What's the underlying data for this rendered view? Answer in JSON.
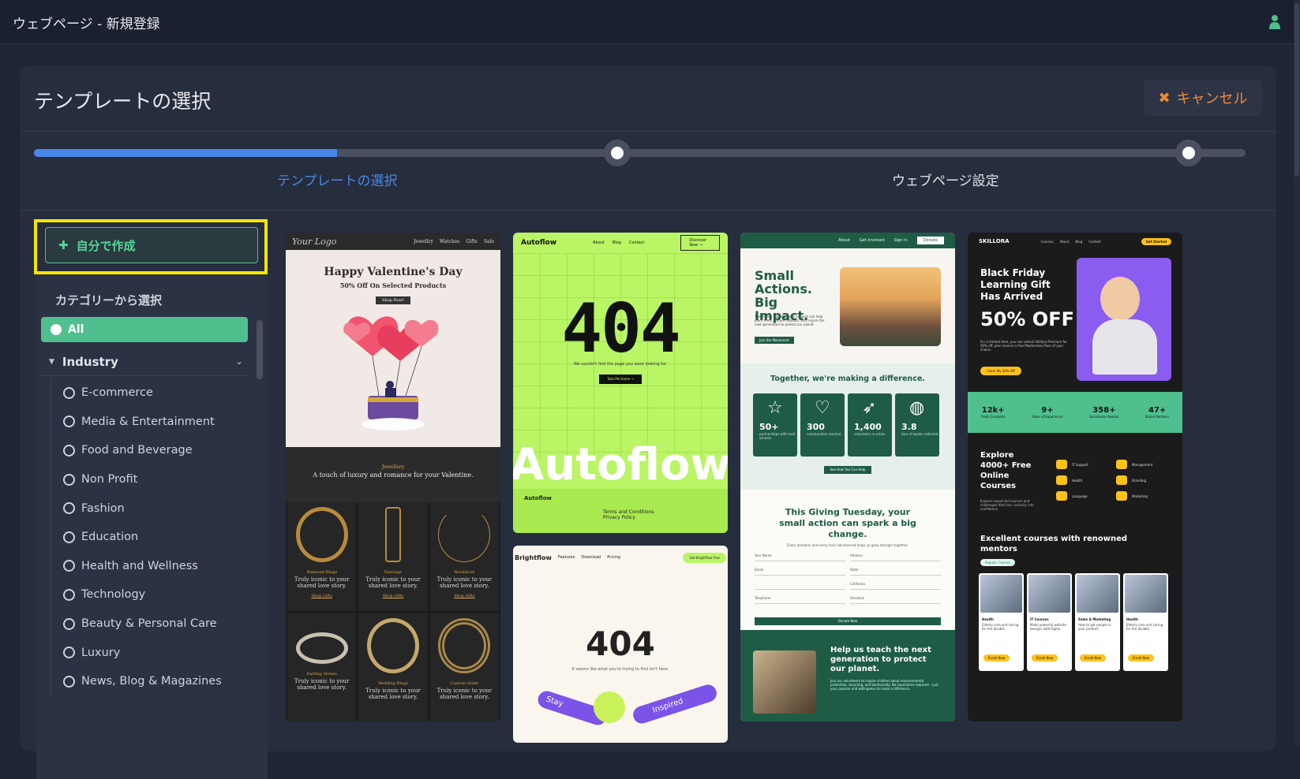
{
  "window": {
    "title": "ウェブページ - 新規登録"
  },
  "header": {
    "title": "テンプレートの選択",
    "cancel_label": "キャンセル"
  },
  "stepper": {
    "progress": 0.25,
    "steps": [
      {
        "label": "テンプレートの選択",
        "state": "active"
      },
      {
        "label": "ウェブページ設定",
        "state": "pending"
      }
    ]
  },
  "sidebar": {
    "create_label": "自分で作成",
    "category_title": "カテゴリーから選択",
    "all_label": "All",
    "group_label": "Industry",
    "items": [
      "E-commerce",
      "Media & Entertainment",
      "Food and Beverage",
      "Non Profit",
      "Fashion",
      "Education",
      "Health and Wellness",
      "Technology",
      "Beauty & Personal Care",
      "Luxury",
      "News, Blog & Magazines"
    ]
  },
  "templates": {
    "valentine": {
      "logo": "Your Logo",
      "nav": [
        "Jewellry",
        "Watches",
        "Gifts",
        "Sale"
      ],
      "heading": "Happy Valentine's Day",
      "sub": "50% Off On Selected Products",
      "button": "Shop Now!",
      "kicker": "Jewellery",
      "tagline": "A touch of luxury and romance for your Valentine.",
      "products": [
        {
          "name": "Diamond Rings",
          "desc": "Truly iconic to your shared love story.",
          "link": "Shop Gifts"
        },
        {
          "name": "Earrings",
          "desc": "Truly iconic to your shared love story.",
          "link": "Shop Gifts"
        },
        {
          "name": "Necklaces",
          "desc": "Truly iconic to your shared love story.",
          "link": "Shop Gifts"
        },
        {
          "name": "Earring Stones",
          "desc": "Truly iconic to your shared love story.",
          "link": ""
        },
        {
          "name": "Wedding Rings",
          "desc": "Truly iconic to your shared love story.",
          "link": ""
        },
        {
          "name": "Custom Order",
          "desc": "Truly iconic to your shared love story.",
          "link": ""
        }
      ]
    },
    "autoflow": {
      "brand": "Autoflow",
      "nav": [
        "About",
        "Blog",
        "Contact"
      ],
      "nav_button": "Discover Now →",
      "code": "404",
      "message": "We couldn't find the page you were looking for.",
      "button": "Take Me Home →",
      "big": "Autoflow",
      "foot_brand": "Autoflow",
      "foot_links": [
        "Terms and Conditions",
        "Privacy Policy"
      ]
    },
    "brightflow": {
      "brand": "Brightflow",
      "nav": [
        "Features",
        "Download",
        "Pricing"
      ],
      "nav_button": "Get Brightflow Free",
      "code": "404",
      "message": "It seems like what you're trying to find isn't here.",
      "ribbon1": "Stay",
      "ribbon2": "Inspired"
    },
    "nonprofit": {
      "nav": [
        "About",
        "Get Involved",
        "Sign In"
      ],
      "nav_button": "Donate",
      "heading": "Small Actions. Big Impact.",
      "para": "This Giving Tuesday, your support can help plant trees, restore habitats, and inspire the next generation to protect our planet.",
      "button": "Join the Movement",
      "stats_title": "Together, we're making a difference.",
      "stats": [
        {
          "icon": "☆",
          "n": "50+",
          "l": "partnerships with local schools"
        },
        {
          "icon": "♡",
          "n": "300",
          "l": "communities reached"
        },
        {
          "icon": "➶",
          "n": "1,400",
          "l": "volunteers in action"
        },
        {
          "icon": "◍",
          "n": "3.8",
          "l": "tons of waste collected"
        }
      ],
      "stats_button": "See How You Can Help",
      "form_title": "This Giving Tuesday, your small action can spark a big change.",
      "form_sub": "Every donation and every hour volunteered helps us grow stronger together.",
      "fields": [
        "Your Name",
        "Address",
        "Email",
        "State",
        "Telephone",
        "Donation"
      ],
      "state_value": "California",
      "form_button": "Donate Now",
      "bottom_title": "Help us teach the next generation to protect our planet.",
      "bottom_para": "Join our volunteers to inspire children about environmental protection, recycling, and biodiversity. No experience required – just your passion and willingness to make a difference."
    },
    "skillora": {
      "brand": "SKILLORA",
      "nav": [
        "Courses",
        "About",
        "Blog",
        "Contact"
      ],
      "nav_button": "Get Started",
      "heading": "Black Friday Learning Gift Has Arrived",
      "offer": "50% OFF",
      "para": "For a limited time, you can unlock Skillora Premium for 50% off, plus receive a free Masterclass Pass of your choice.",
      "button": "Claim My 50% Off",
      "stats": [
        {
          "n": "12k+",
          "l": "Fresh Graduate"
        },
        {
          "n": "9+",
          "l": "Years of Experience"
        },
        {
          "n": "358+",
          "l": "Excellence Awards"
        },
        {
          "n": "47+",
          "l": "Brand Partners"
        }
      ],
      "explore_title": "Explore 4000+ Free Online Courses",
      "explore_para": "Explore expert-led courses and challenges that turn curiosity into confidence.",
      "tags": [
        "IT Support",
        "Management",
        "Health",
        "Branding",
        "Language",
        "Marketing"
      ],
      "mentors_title": "Excellent courses with renowned mentors",
      "mentors_pill": "Popular Courses",
      "courses": [
        {
          "n": "Health",
          "d": "Elderly care and caring for the disable",
          "b": "Enroll Now"
        },
        {
          "n": "IT Courses",
          "d": "Make powerful website designs with Figma",
          "b": "Enroll Now"
        },
        {
          "n": "Sales & Marketing",
          "d": "How to get people in your product",
          "b": "Enroll Now"
        },
        {
          "n": "Health",
          "d": "Elderly care and caring for the disable",
          "b": "Enroll Now"
        }
      ]
    }
  }
}
